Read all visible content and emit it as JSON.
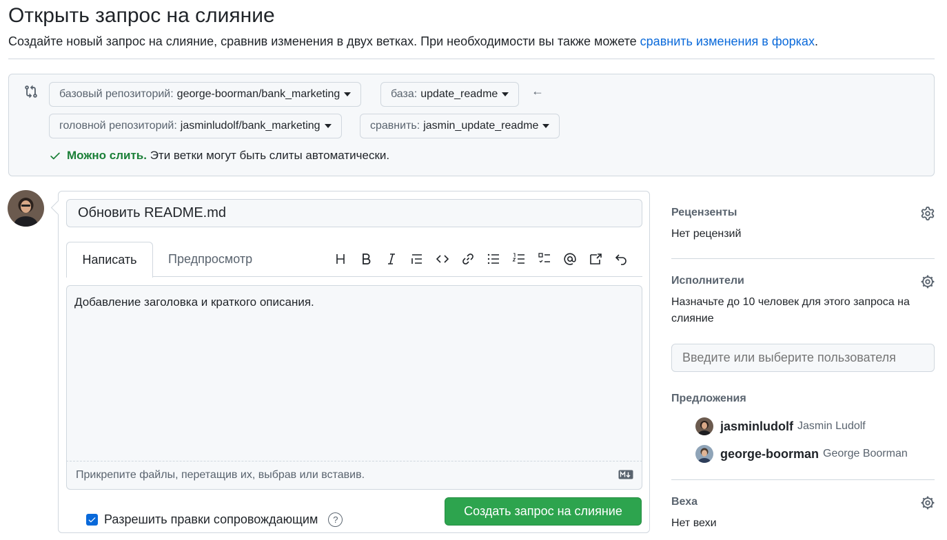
{
  "header": {
    "title": "Открыть запрос на слияние",
    "subtitle_text": "Создайте новый запрос на слияние, сравнив изменения в двух ветках. При необходимости вы также можете ",
    "subtitle_link": "сравнить изменения в форках",
    "subtitle_end": "."
  },
  "compare": {
    "base_repo_label": "базовый репозиторий:",
    "base_repo_value": "george-boorman/bank_marketing",
    "base_label": "база:",
    "base_value": "update_readme",
    "head_repo_label": "головной репозиторий:",
    "head_repo_value": "jasminludolf/bank_marketing",
    "compare_label": "сравнить:",
    "compare_value": "jasmin_update_readme",
    "merge_ok": "Можно слить.",
    "merge_text": "Эти ветки могут быть слиты автоматически."
  },
  "editor": {
    "title_value": "Обновить README.md",
    "tab_write": "Написать",
    "tab_preview": "Предпросмотр",
    "body_text": "Добавление заголовка и краткого описания.",
    "attach_text": "Прикрепите файлы, перетащив их, выбрав или вставив.",
    "toolbar_icons": [
      "heading-icon",
      "bold-icon",
      "italic-icon",
      "quote-icon",
      "code-icon",
      "link-icon",
      "unordered-list-icon",
      "ordered-list-icon",
      "task-list-icon",
      "mention-icon",
      "cross-reference-icon",
      "undo-icon"
    ],
    "allow_edits_label": "Разрешить правки сопровождающим",
    "allow_edits_checked": true,
    "create_button": "Создать запрос на слияние"
  },
  "sidebar": {
    "reviewers_heading": "Рецензенты",
    "reviewers_value": "Нет рецензий",
    "assignees_heading": "Исполнители",
    "assignees_value": "Назначьте до 10 человек для этого запроса на слияние",
    "assignees_placeholder": "Введите или выберите пользователя",
    "suggestions_heading": "Предложения",
    "suggestions": [
      {
        "login": "jasminludolf",
        "name": "Jasmin Ludolf"
      },
      {
        "login": "george-boorman",
        "name": "George Boorman"
      }
    ],
    "milestone_heading": "Веха",
    "milestone_value": "Нет вехи"
  },
  "colors": {
    "accent_blue": "#0969da",
    "success_green": "#1a7f37",
    "button_green": "#2da44e",
    "border": "#d0d7de",
    "muted_text": "#59636e"
  }
}
